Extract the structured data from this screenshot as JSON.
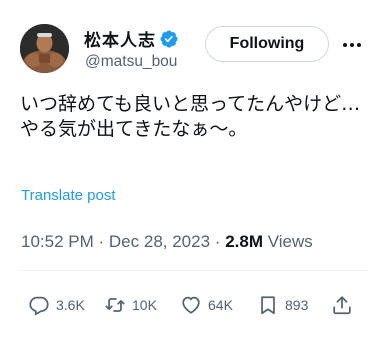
{
  "author": {
    "display_name": "松本人志",
    "handle": "@matsu_bou",
    "verified": true
  },
  "header": {
    "follow_label": "Following",
    "more_icon": "more-horizontal-icon"
  },
  "tweet": {
    "text": "いつ辞めても良いと思ってたんやけど…\nやる気が出てきたなぁ〜。",
    "translate_label": "Translate post",
    "time": "10:52 PM",
    "separator": "·",
    "date": "Dec 28, 2023",
    "views_count": "2.8M",
    "views_label": "Views"
  },
  "actions": {
    "reply_count": "3.6K",
    "repost_count": "10K",
    "like_count": "64K",
    "bookmark_count": "893"
  },
  "colors": {
    "accent": "#1d9bf0",
    "muted": "#536471",
    "text": "#0f1419",
    "border": "#cfd9de"
  }
}
